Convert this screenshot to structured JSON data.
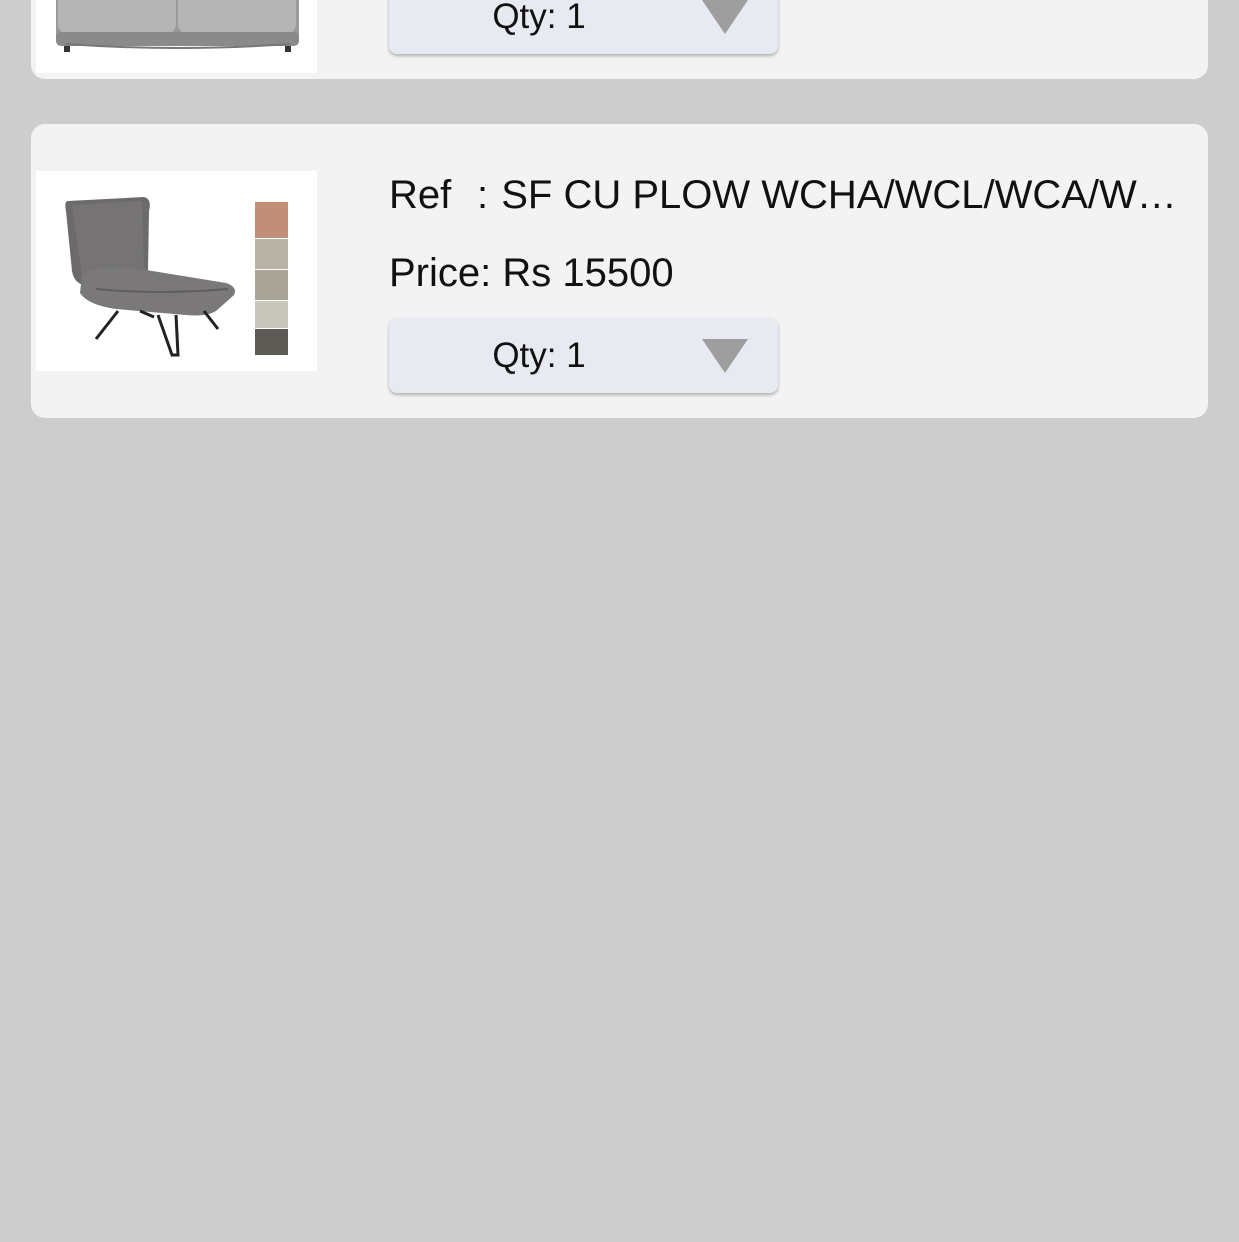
{
  "items": [
    {
      "product_image": "grey-sofa-image",
      "qty_label": "Qty: 1"
    },
    {
      "product_image": "grey-lounge-chair-image",
      "ref_label": "Ref",
      "ref_separator": ":",
      "ref_value": "SF CU PLOW WCHA/WCL/WCA/WCB",
      "price_label": "Price:",
      "price_value": "Rs 15500",
      "qty_label": "Qty: 1",
      "swatches": [
        "#c18e77",
        "#b9b2a6",
        "#aaa397",
        "#c9c6bc",
        "#5e5a55"
      ]
    }
  ],
  "colors": {
    "background": "#cdcdcd",
    "card": "#f3f3f3",
    "qty_button": "#e8eaf1",
    "caret": "#9e9e9e"
  }
}
